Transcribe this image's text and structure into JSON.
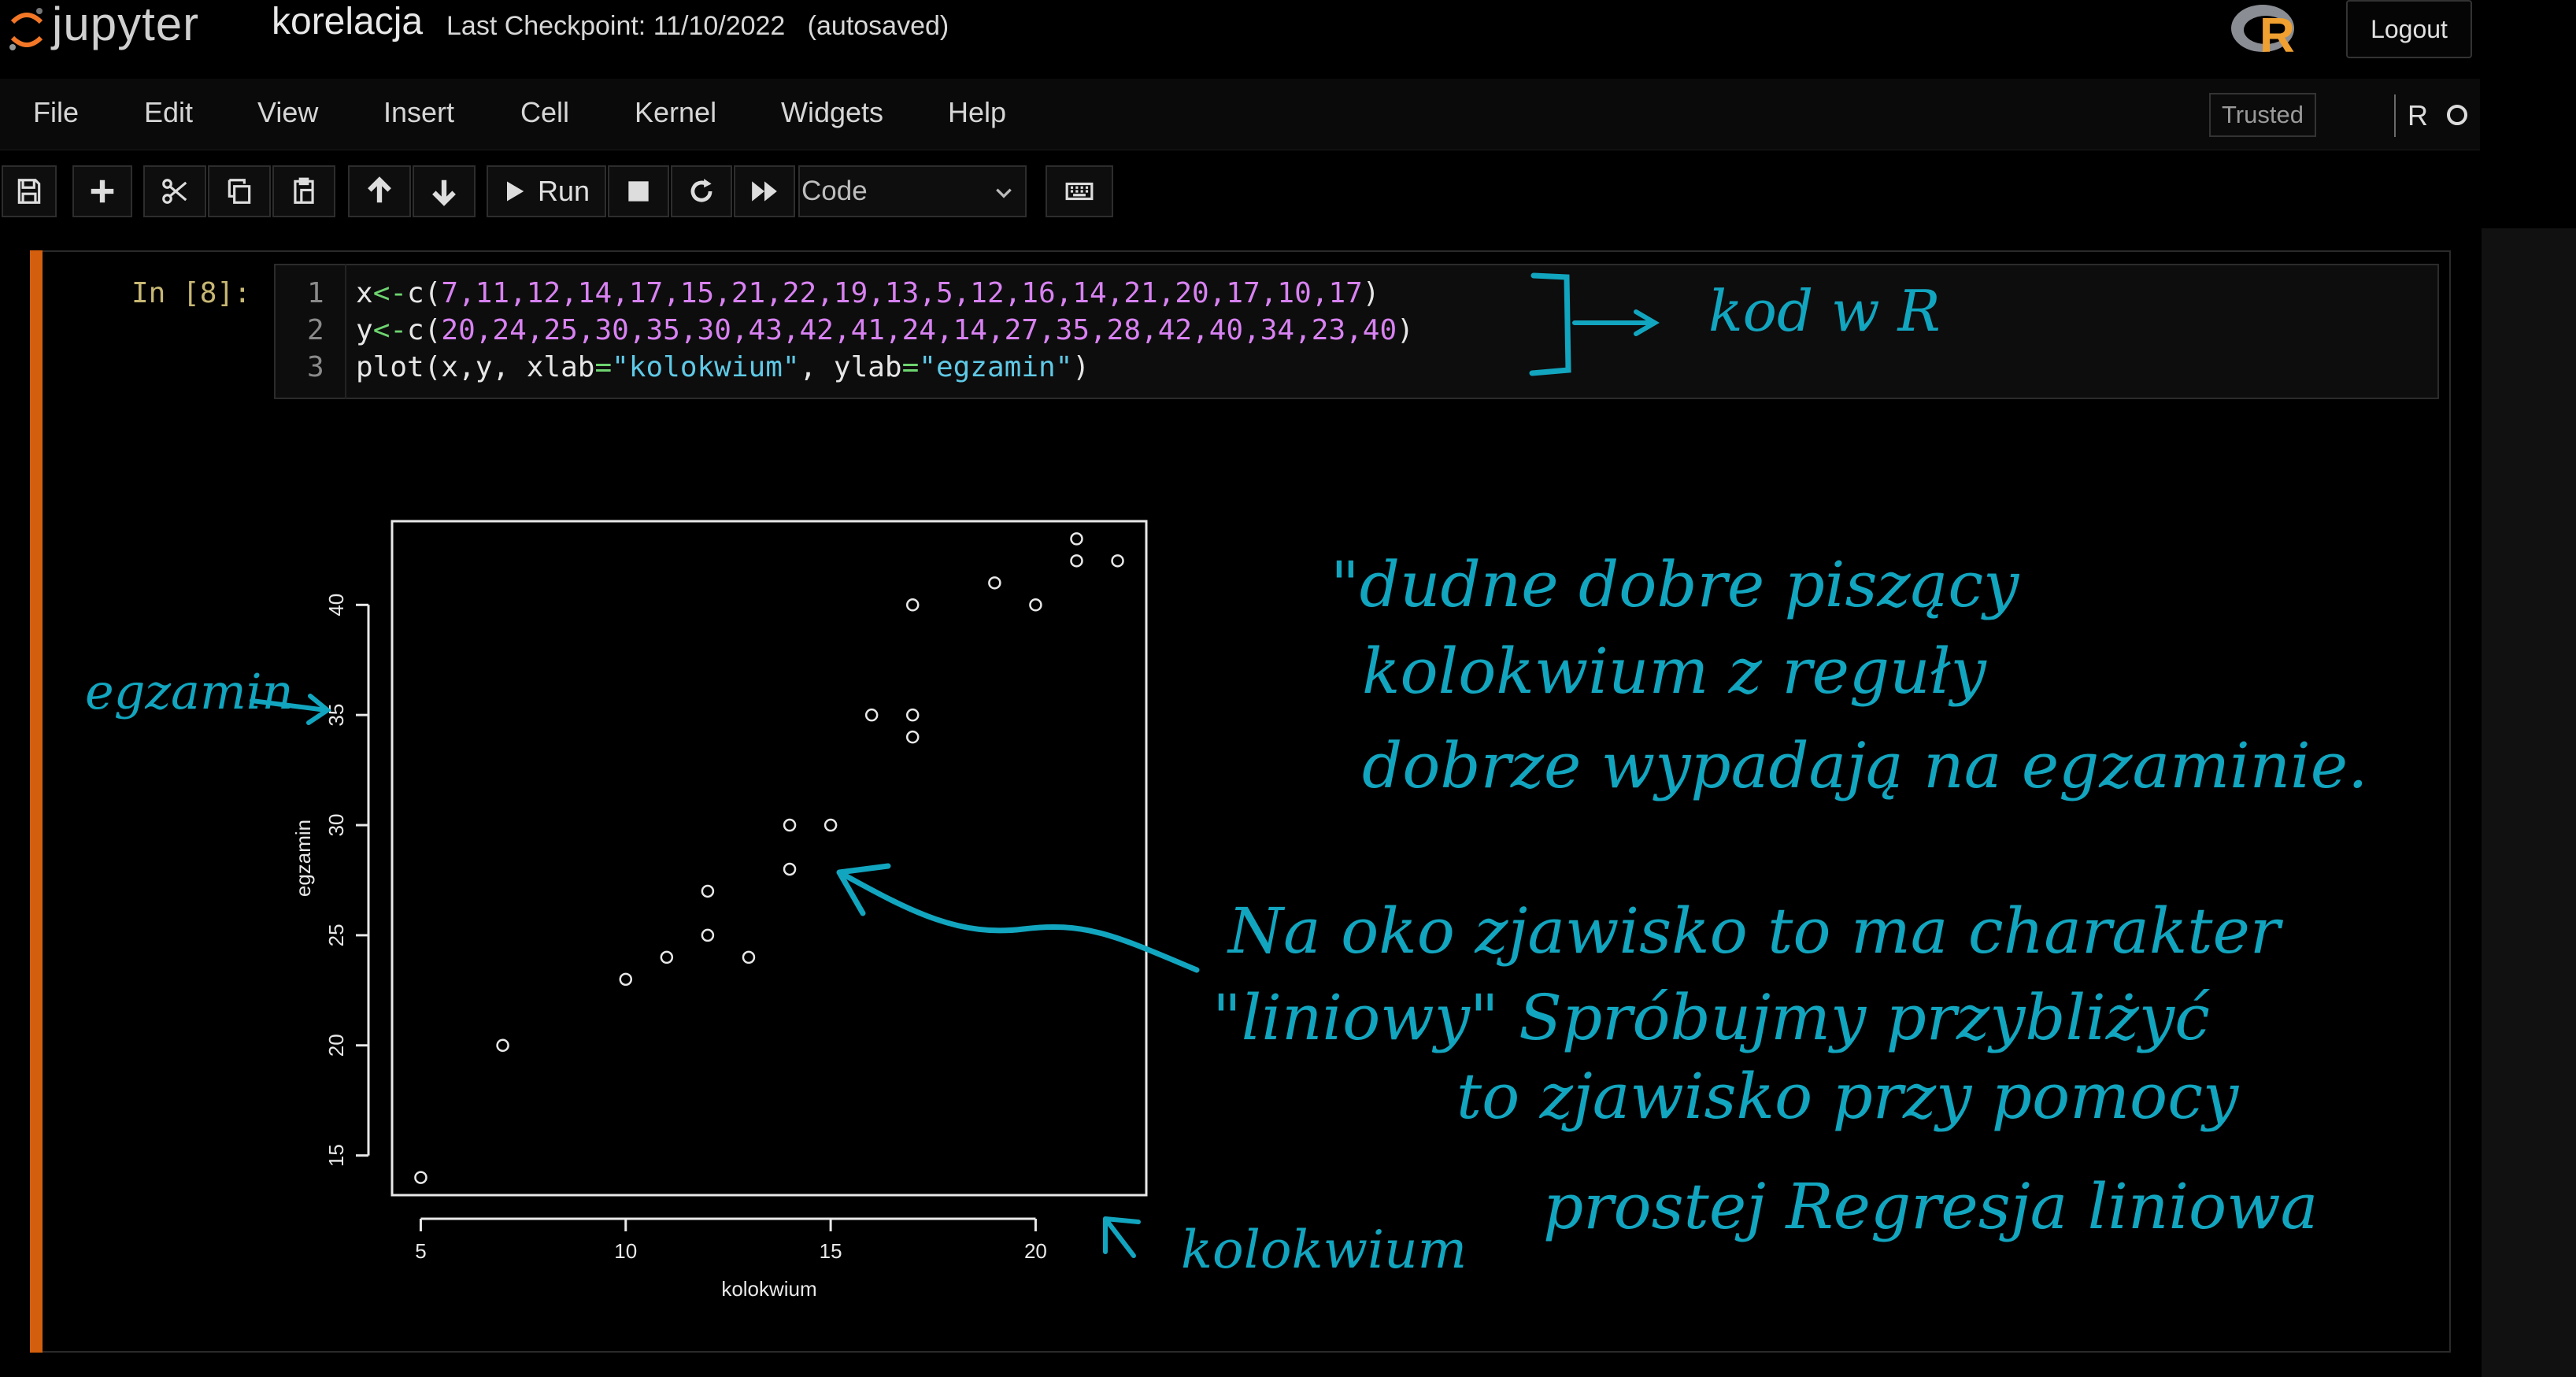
{
  "header": {
    "logo_text": "jupyter",
    "notebook_title": "korelacja",
    "checkpoint": "Last Checkpoint: 11/10/2022   (autosaved)",
    "r_logo_letter": "R",
    "logout_label": "Logout"
  },
  "menu": {
    "items": [
      "File",
      "Edit",
      "View",
      "Insert",
      "Cell",
      "Kernel",
      "Widgets",
      "Help"
    ],
    "trusted_label": "Trusted",
    "kernel_name": "R"
  },
  "toolbar": {
    "run_label": "Run",
    "cell_type": "Code",
    "icons": [
      "save-icon",
      "plus-icon",
      "cut-icon",
      "copy-icon",
      "paste-icon",
      "arrow-up-icon",
      "arrow-down-icon",
      "play-icon",
      "stop-icon",
      "restart-icon",
      "fast-forward-icon",
      "keyboard-icon"
    ]
  },
  "cell": {
    "prompt": "In [8]:",
    "line_numbers": [
      "1",
      "2",
      "3"
    ]
  },
  "colors": {
    "cell_bar": "#d35f0e",
    "ink": "#12a5bf",
    "number": "#d882f2",
    "operator": "#6ed470",
    "string": "#5fc9e6"
  },
  "annotations": {
    "code_note": "kod w R",
    "quote1_line1": "\"dudne dobre piszący",
    "quote1_line2": "kolokwium z reguły",
    "quote1_line3": "dobrze wypadają na egzaminie.",
    "quote2_line1": "Na oko zjawisko to ma charakter",
    "quote2_line2": "\"liniowy\" Spróbujmy przybliżyć",
    "quote2_line3": "to zjawisko przy pomocy",
    "quote2_line4": "prostej Regresja liniowa",
    "ylabel_note": "egzamin",
    "xlabel_note": "kolokwium"
  },
  "chart_data": {
    "type": "scatter",
    "title": "",
    "xlabel": "kolokwium",
    "ylabel": "egzamin",
    "x": [
      7,
      11,
      12,
      14,
      17,
      15,
      21,
      22,
      19,
      13,
      5,
      12,
      16,
      14,
      21,
      20,
      17,
      10,
      17
    ],
    "y": [
      20,
      24,
      25,
      30,
      35,
      30,
      43,
      42,
      41,
      24,
      14,
      27,
      35,
      28,
      42,
      40,
      34,
      23,
      40
    ],
    "xlim": [
      4.3,
      22.7
    ],
    "ylim": [
      13.2,
      43.8
    ],
    "xticks": [
      5,
      10,
      15,
      20
    ],
    "yticks": [
      15,
      20,
      25,
      30,
      35,
      40
    ],
    "grid": false,
    "marker": "open circle"
  }
}
